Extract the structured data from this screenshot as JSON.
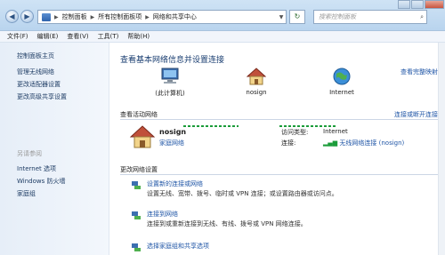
{
  "addressbar": {
    "crumbs": [
      "控制面板",
      "所有控制面板项",
      "网络和共享中心"
    ],
    "search_placeholder": "搜索控制面板"
  },
  "menu": [
    "文件(F)",
    "编辑(E)",
    "查看(V)",
    "工具(T)",
    "帮助(H)"
  ],
  "leftpane": {
    "home": "控制面板主页",
    "links": [
      "管理无线网络",
      "更改适配器设置",
      "更改高级共享设置"
    ],
    "see_also_label": "另请参阅",
    "see_also": [
      "Internet 选项",
      "Windows 防火墙",
      "家庭组"
    ]
  },
  "main": {
    "title": "查看基本网络信息并设置连接",
    "full_map": "查看完整映射",
    "map": {
      "computer": "(此计算机)",
      "network": "nosign",
      "internet": "Internet"
    },
    "active_networks_header": "查看活动网络",
    "connect_disconnect": "连接或断开连接",
    "network": {
      "name": "nosign",
      "type": "家庭网络",
      "access_type_label": "访问类型:",
      "access_type_value": "Internet",
      "connection_label": "连接:",
      "connection_value": "无线网络连接 (nosign)"
    },
    "change_settings_header": "更改网络设置",
    "tasks": [
      {
        "title": "设置新的连接或网络",
        "desc": "设置无线、宽带、拨号、临时或 VPN 连接；或设置路由器或访问点。"
      },
      {
        "title": "连接到网络",
        "desc": "连接到或重新连接到无线、有线、拨号或 VPN 网络连接。"
      },
      {
        "title": "选择家庭组和共享选项",
        "desc": ""
      }
    ]
  },
  "colors": {
    "link": "#1f55a6",
    "title": "#1b3f72",
    "connector": "#1c9c3a"
  },
  "icons": {
    "back": "back-arrow-icon",
    "forward": "forward-arrow-icon",
    "refresh": "refresh-icon",
    "search": "search-icon",
    "computer": "computer-icon",
    "house": "house-icon",
    "globe": "globe-icon",
    "signal": "wireless-signal-icon",
    "task": "network-task-icon"
  }
}
